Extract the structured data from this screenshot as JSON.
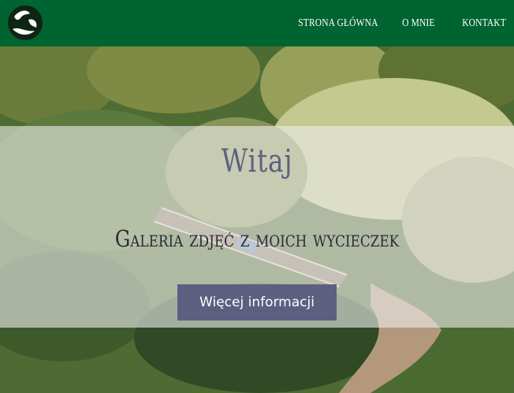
{
  "nav": {
    "logo_icon": "globe-leaf-icon",
    "links": [
      "STRONA GŁÓWNA",
      "O MNIE",
      "KONTAKT"
    ]
  },
  "hero": {
    "title": "Witaj",
    "subtitle": "Galeria zdjęć z moich wycieczek",
    "button_label": "Więcej informacji"
  },
  "colors": {
    "navbar": "#006430",
    "title": "#5e607f",
    "button": "#5c5f80",
    "overlay": "rgba(235,235,232,0.62)"
  }
}
